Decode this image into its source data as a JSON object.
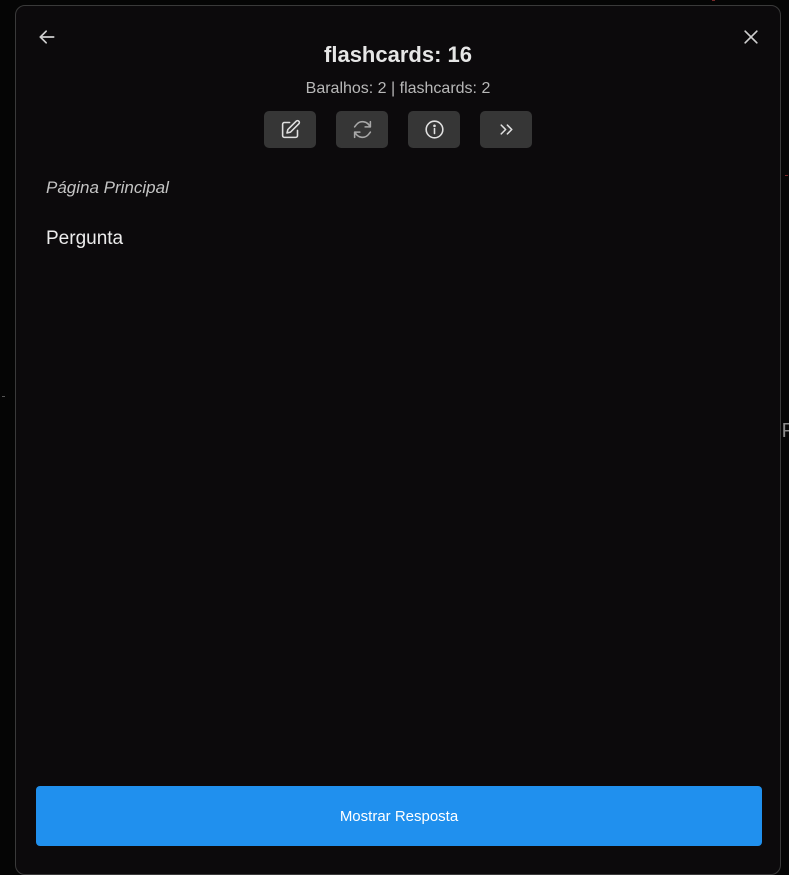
{
  "header": {
    "title": "flashcards: 16",
    "subtitle": "Baralhos: 2 | flashcards: 2"
  },
  "icons": {
    "back": "arrow-left-icon",
    "close": "close-icon",
    "edit": "edit-icon",
    "reset": "refresh-icon",
    "info": "info-icon",
    "skip": "chevrons-right-icon"
  },
  "card": {
    "breadcrumb": "Página Principal",
    "question": "Pergunta"
  },
  "actions": {
    "show_answer_label": "Mostrar Resposta"
  },
  "background": {
    "partial_text": "P"
  },
  "colors": {
    "primary_button": "#2090ee",
    "modal_bg": "#0c0a0c",
    "tool_button_bg": "#363636"
  }
}
